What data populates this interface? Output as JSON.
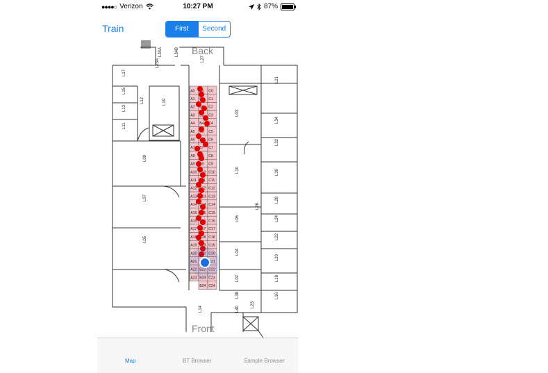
{
  "status_bar": {
    "signal_dots": "●●●●○",
    "carrier": "Verizon",
    "wifi_icon": "wifi-icon",
    "time": "10:27 PM",
    "location_icon": "location-arrow-icon",
    "bluetooth_icon": "bluetooth-icon",
    "battery": "87%",
    "battery_level": 0.87
  },
  "nav": {
    "left_button": "Train",
    "segments": [
      {
        "label": "First",
        "selected": true
      },
      {
        "label": "Second",
        "selected": false
      }
    ]
  },
  "map": {
    "back_label": "Back",
    "front_label": "Front",
    "room_labels": [
      "L34A",
      "L34B",
      "L27",
      "L23A",
      "L17",
      "L15",
      "L13",
      "L11",
      "L19",
      "L12",
      "L09",
      "L07",
      "L05",
      "L03",
      "L10",
      "L06",
      "L04",
      "L02",
      "L38",
      "L40",
      "L21",
      "L34",
      "L32",
      "L30",
      "L28",
      "L24",
      "L22",
      "L20",
      "L18",
      "L16",
      "L14",
      "L26",
      "L23"
    ],
    "grid_a": [
      "A0",
      "A1",
      "A2",
      "A3",
      "A4",
      "A5",
      "A6",
      "A7",
      "A8",
      "A9",
      "A10",
      "A11",
      "A12",
      "A13",
      "A14",
      "A15",
      "A16",
      "A17",
      "A18",
      "A19",
      "A20",
      "A21",
      "A22",
      "A23"
    ],
    "grid_b": [
      "B0",
      "B1",
      "B2",
      "B3",
      "B4",
      "B5",
      "B6",
      "B7",
      "B8",
      "B9",
      "B10",
      "B11",
      "B12",
      "B13",
      "B14",
      "B15",
      "B16",
      "B17",
      "B18",
      "B19",
      "B20",
      "B21",
      "B22",
      "B23",
      "B24"
    ],
    "grid_c": [
      "C0",
      "C1",
      "C2",
      "C3",
      "C4",
      "C5",
      "C6",
      "C7",
      "C8",
      "C9",
      "C10",
      "C11",
      "C12",
      "C13",
      "C14",
      "C15",
      "C16",
      "C17",
      "C18",
      "C19",
      "C20",
      "C21",
      "C22",
      "C23",
      "C24"
    ],
    "accent_blue": "#1a6fdc",
    "marker_red": "#e00000",
    "cell_fill": "#f5c6cc"
  },
  "tabs": [
    {
      "label": "Map",
      "active": true
    },
    {
      "label": "BT Browser",
      "active": false
    },
    {
      "label": "Sample Browser",
      "active": false
    }
  ]
}
